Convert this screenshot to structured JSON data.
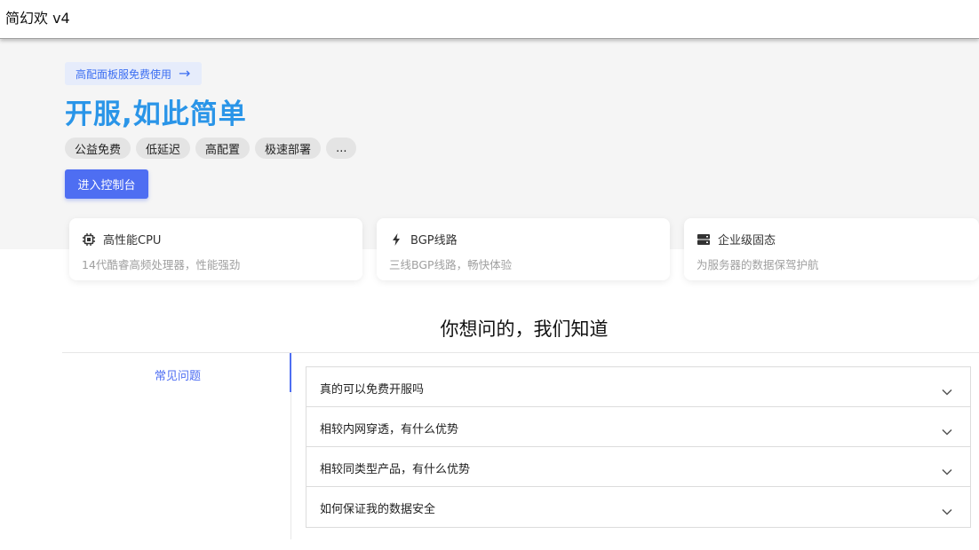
{
  "window": {
    "title": "简幻欢 v4"
  },
  "hero": {
    "promo": {
      "label": "高配面板服免费使用",
      "arrow": "→"
    },
    "headline": "开服,如此简单",
    "tags": [
      "公益免费",
      "低延迟",
      "高配置",
      "极速部署",
      "..."
    ],
    "cta_label": "进入控制台"
  },
  "features": [
    {
      "icon": "cpu-icon",
      "title": "高性能CPU",
      "desc": "14代酷睿高频处理器，性能强劲"
    },
    {
      "icon": "lightning-icon",
      "title": "BGP线路",
      "desc": "三线BGP线路，畅快体验"
    },
    {
      "icon": "server-icon",
      "title": "企业级固态",
      "desc": "为服务器的数据保驾护航"
    }
  ],
  "faq_section": {
    "title": "你想问的，我们知道",
    "sidebar": [
      {
        "label": "常见问题",
        "active": true
      }
    ],
    "questions": [
      {
        "q": "真的可以免费开服吗",
        "icon": "chevron-down-icon"
      },
      {
        "q": "相较内网穿透，有什么优势",
        "icon": "chevron-down-icon"
      },
      {
        "q": "相较同类型产品，有什么优势",
        "icon": "chevron-down-icon"
      },
      {
        "q": "如何保证我的数据安全",
        "icon": "chevron-down-icon"
      }
    ]
  },
  "colors": {
    "accent": "#4e6ef2",
    "headline": "#2a95e8",
    "hero_bg": "#f5f5f5"
  }
}
